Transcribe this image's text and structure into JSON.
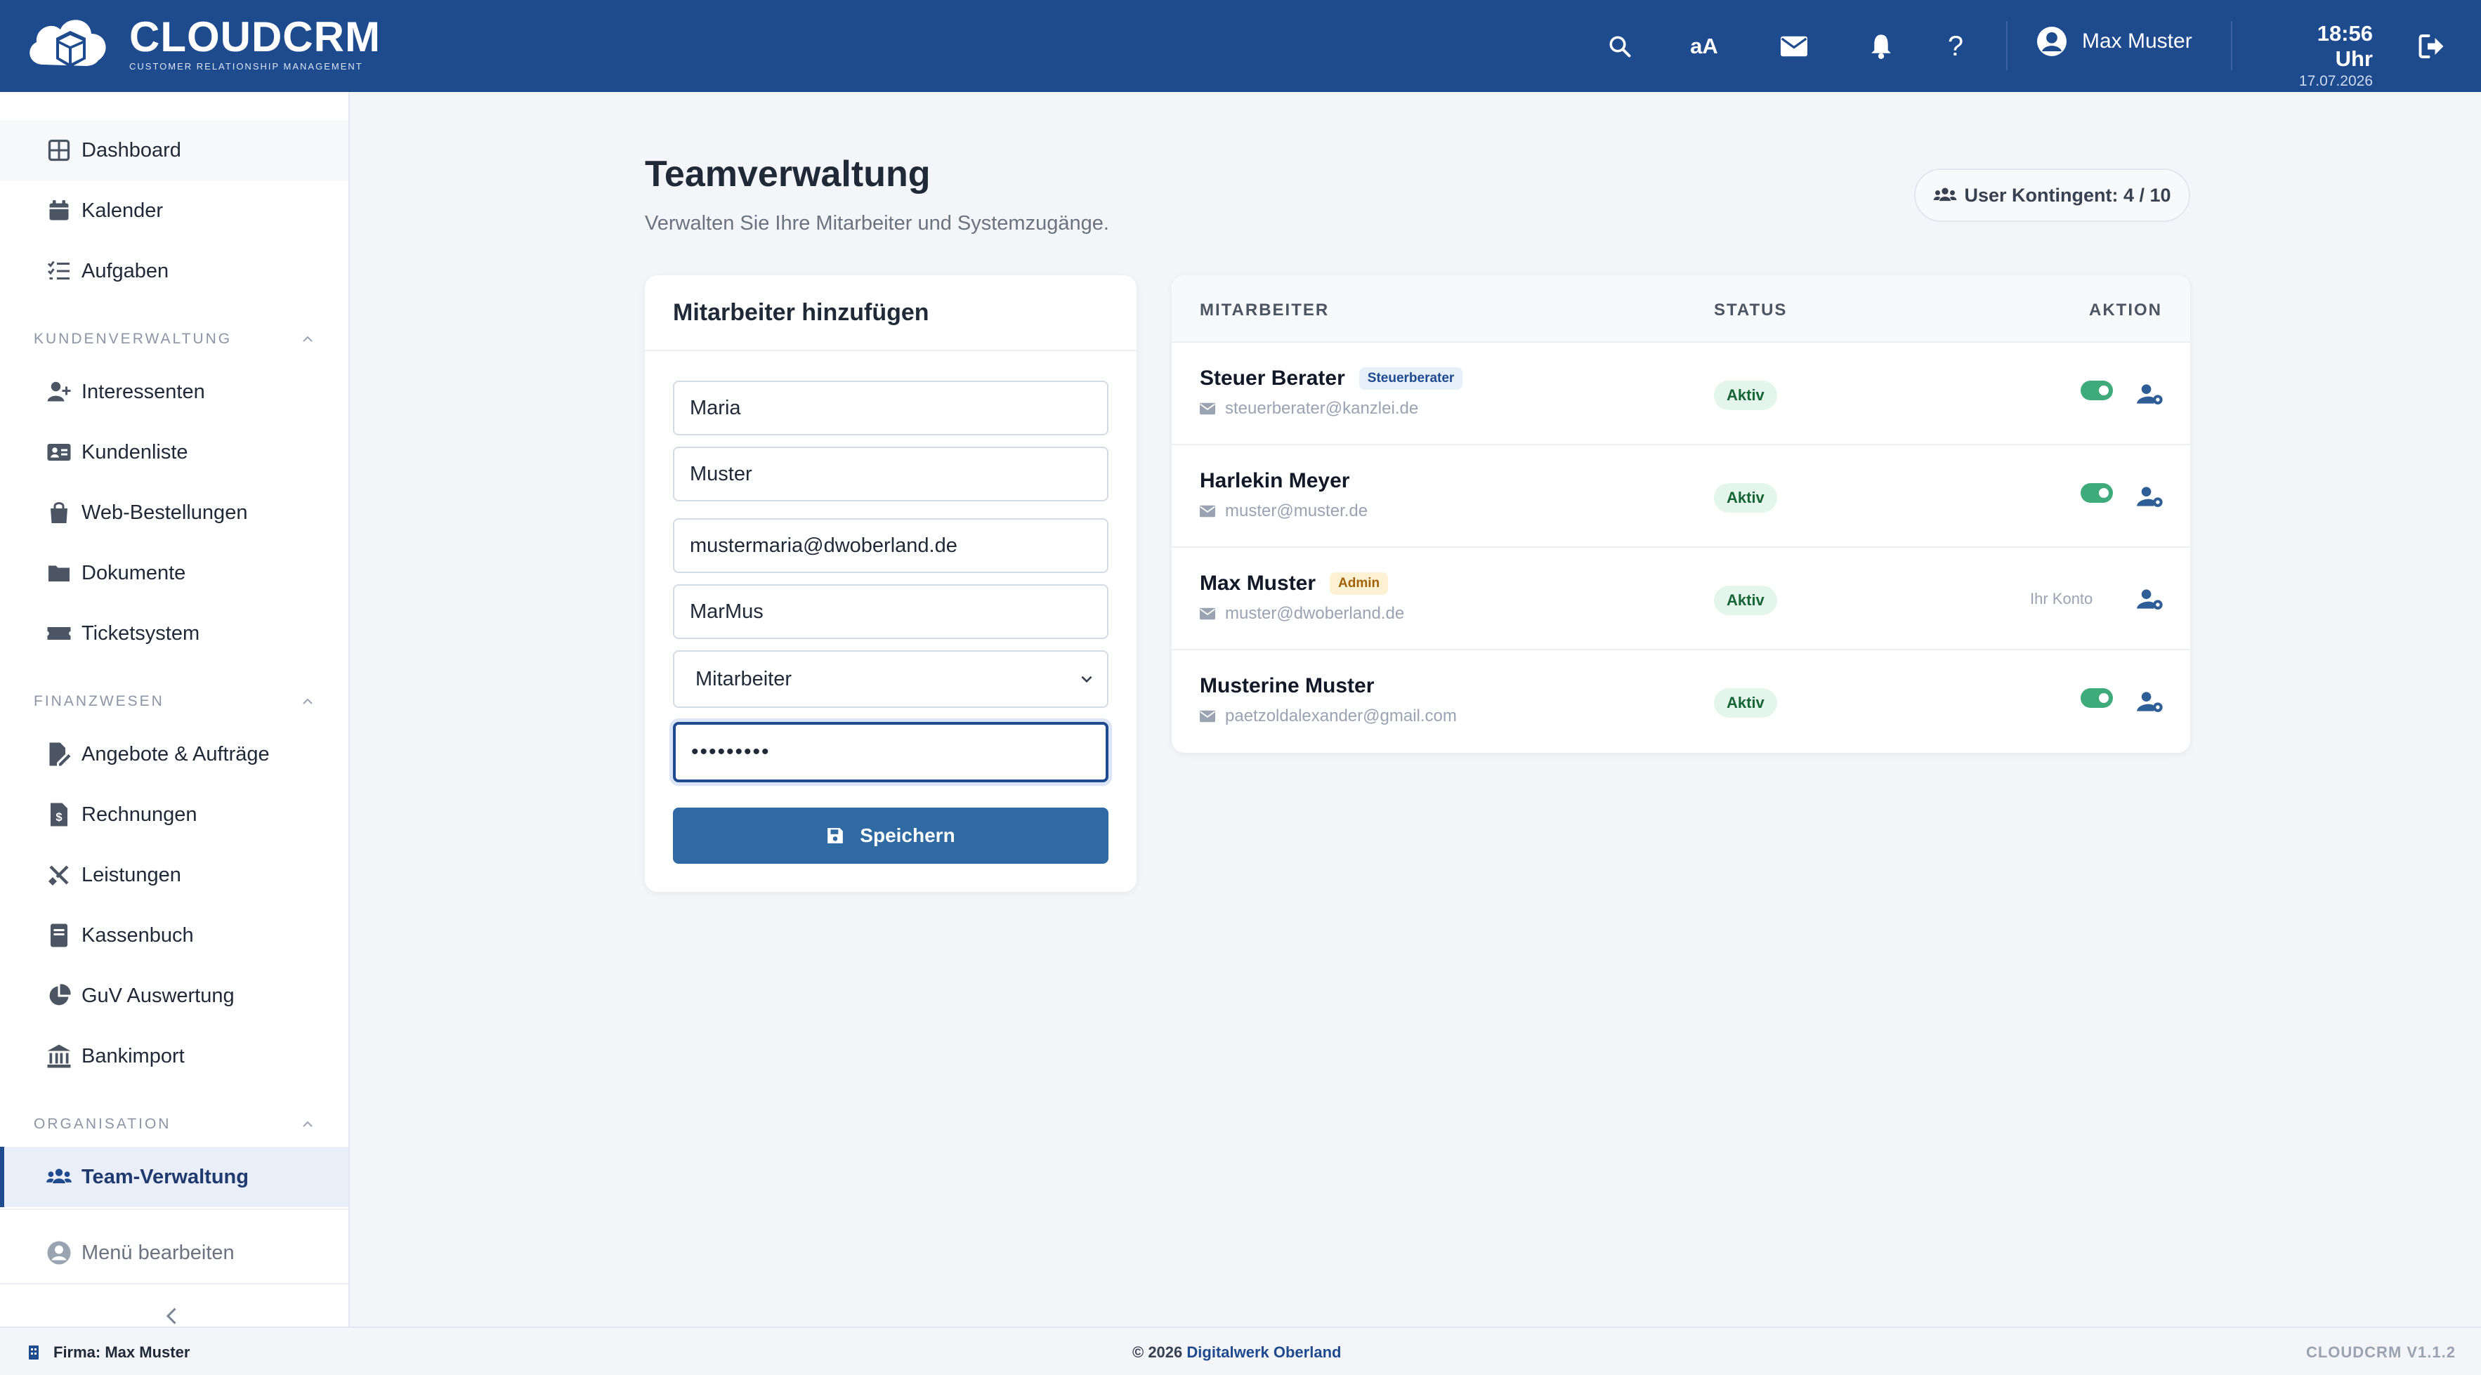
{
  "app": {
    "logo_title": "CLOUDCRM",
    "logo_subtitle": "CUSTOMER RELATIONSHIP MANAGEMENT",
    "brand_color": "#1e4a8e"
  },
  "header": {
    "font_size_label": "aA",
    "user_name": "Max Muster",
    "time": "18:56 Uhr",
    "date": "17.07.2026",
    "icons": [
      "search-icon",
      "font-size-icon",
      "mail-icon",
      "bell-icon",
      "help-icon",
      "user-avatar-icon",
      "logout-icon"
    ]
  },
  "sidebar": {
    "top_items": [
      {
        "label": "Dashboard",
        "icon": "grid-icon"
      },
      {
        "label": "Kalender",
        "icon": "calendar-icon"
      },
      {
        "label": "Aufgaben",
        "icon": "task-list-icon"
      }
    ],
    "sections": [
      {
        "title": "KUNDENVERWALTUNG",
        "items": [
          {
            "label": "Interessenten",
            "icon": "user-plus-icon"
          },
          {
            "label": "Kundenliste",
            "icon": "id-card-icon"
          },
          {
            "label": "Web-Bestellungen",
            "icon": "shopping-bag-icon"
          },
          {
            "label": "Dokumente",
            "icon": "folder-icon"
          },
          {
            "label": "Ticketsystem",
            "icon": "ticket-icon"
          }
        ]
      },
      {
        "title": "FINANZWESEN",
        "items": [
          {
            "label": "Angebote & Aufträge",
            "icon": "file-edit-icon"
          },
          {
            "label": "Rechnungen",
            "icon": "invoice-icon"
          },
          {
            "label": "Leistungen",
            "icon": "tools-icon"
          },
          {
            "label": "Kassenbuch",
            "icon": "book-icon"
          },
          {
            "label": "GuV Auswertung",
            "icon": "pie-chart-icon"
          },
          {
            "label": "Bankimport",
            "icon": "bank-icon"
          }
        ]
      },
      {
        "title": "ORGANISATION",
        "items": [
          {
            "label": "Team-Verwaltung",
            "icon": "users-icon",
            "active": true
          }
        ]
      }
    ],
    "edit_menu": "Menü bearbeiten"
  },
  "main": {
    "title": "Teamverwaltung",
    "subtitle": "Verwalten Sie Ihre Mitarbeiter und Systemzugänge.",
    "quota_label": "User Kontingent: 4 / 10",
    "form": {
      "title": "Mitarbeiter hinzufügen",
      "first_name": "Maria",
      "last_name": "Muster",
      "email": "mustermaria@dwoberland.de",
      "username": "MarMus",
      "role": "Mitarbeiter",
      "password_mask": "•••••••••",
      "save_label": "Speichern"
    },
    "table": {
      "headers": {
        "employee": "MITARBEITER",
        "status": "STATUS",
        "action": "AKTION"
      },
      "rows": [
        {
          "name": "Steuer Berater",
          "badge": "Steuerberater",
          "email": "steuerberater@kanzlei.de",
          "status": "Aktiv",
          "toggle": true
        },
        {
          "name": "Harlekin Meyer",
          "badge": "",
          "email": "muster@muster.de",
          "status": "Aktiv",
          "toggle": true
        },
        {
          "name": "Max Muster",
          "badge": "Admin",
          "email": "muster@dwoberland.de",
          "status": "Aktiv",
          "own_account": "Ihr Konto"
        },
        {
          "name": "Musterine Muster",
          "badge": "",
          "email": "paetzoldalexander@gmail.com",
          "status": "Aktiv",
          "toggle": true
        }
      ]
    }
  },
  "footer": {
    "firm": "Firma: Max Muster",
    "copyright_prefix": "© 2026 ",
    "company": "Digitalwerk Oberland",
    "version": "CLOUDCRM V1.1.2"
  }
}
